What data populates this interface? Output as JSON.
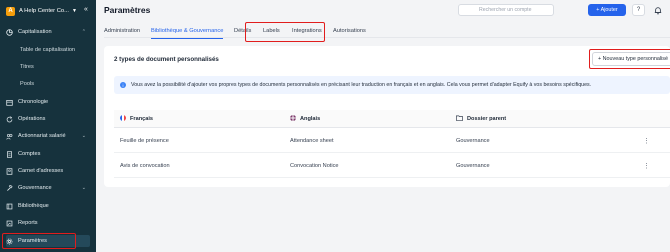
{
  "sidebar": {
    "org_name": "A Help Center Co...",
    "org_initial": "A",
    "items": [
      {
        "label": "Capitalisation",
        "icon": "pie-chart-icon",
        "expanded": true
      },
      {
        "label": "Table de capitalisation"
      },
      {
        "label": "Titres"
      },
      {
        "label": "Pools"
      },
      {
        "label": "Chronologie",
        "icon": "calendar-icon"
      },
      {
        "label": "Opérations",
        "icon": "refresh-icon"
      },
      {
        "label": "Actionnariat salarié",
        "icon": "people-icon"
      },
      {
        "label": "Comptes",
        "icon": "document-icon"
      },
      {
        "label": "Carnet d'adresses",
        "icon": "address-book-icon"
      },
      {
        "label": "Gouvernance",
        "icon": "gavel-icon"
      },
      {
        "label": "Bibliothèque",
        "icon": "library-icon"
      },
      {
        "label": "Reports",
        "icon": "report-icon"
      },
      {
        "label": "Paramètres",
        "icon": "gear-icon",
        "active": true
      }
    ]
  },
  "header": {
    "title": "Paramètres",
    "search_placeholder": "Rechercher un compte",
    "add_label": "+ Ajouter",
    "help_label": "?"
  },
  "tabs": [
    {
      "label": "Administration"
    },
    {
      "label": "Bibliothèque & Gouvernance",
      "active": true
    },
    {
      "label": "Détails"
    },
    {
      "label": "Labels"
    },
    {
      "label": "Integrations"
    },
    {
      "label": "Autorisations"
    }
  ],
  "card": {
    "title": "2 types de document personnalisés",
    "new_button_label": "+ Nouveau type personnalisé",
    "info_text": "Vous avez la possibilité d'ajouter vos propres types de documents personnalisés en précisant leur traduction en français et en anglais. Cela vous permet d'adapter Equify à vos besoins spécifiques."
  },
  "table": {
    "columns": [
      "Français",
      "Anglais",
      "Dossier parent"
    ],
    "rows": [
      {
        "fr": "Feuille de présence",
        "en": "Attendance sheet",
        "parent": "Gouvernance"
      },
      {
        "fr": "Avis de convocation",
        "en": "Convocation Notice",
        "parent": "Gouvernance"
      }
    ]
  },
  "colors": {
    "sidebar_bg": "#16323d",
    "accent": "#2563eb",
    "highlight": "#e11d1d"
  }
}
